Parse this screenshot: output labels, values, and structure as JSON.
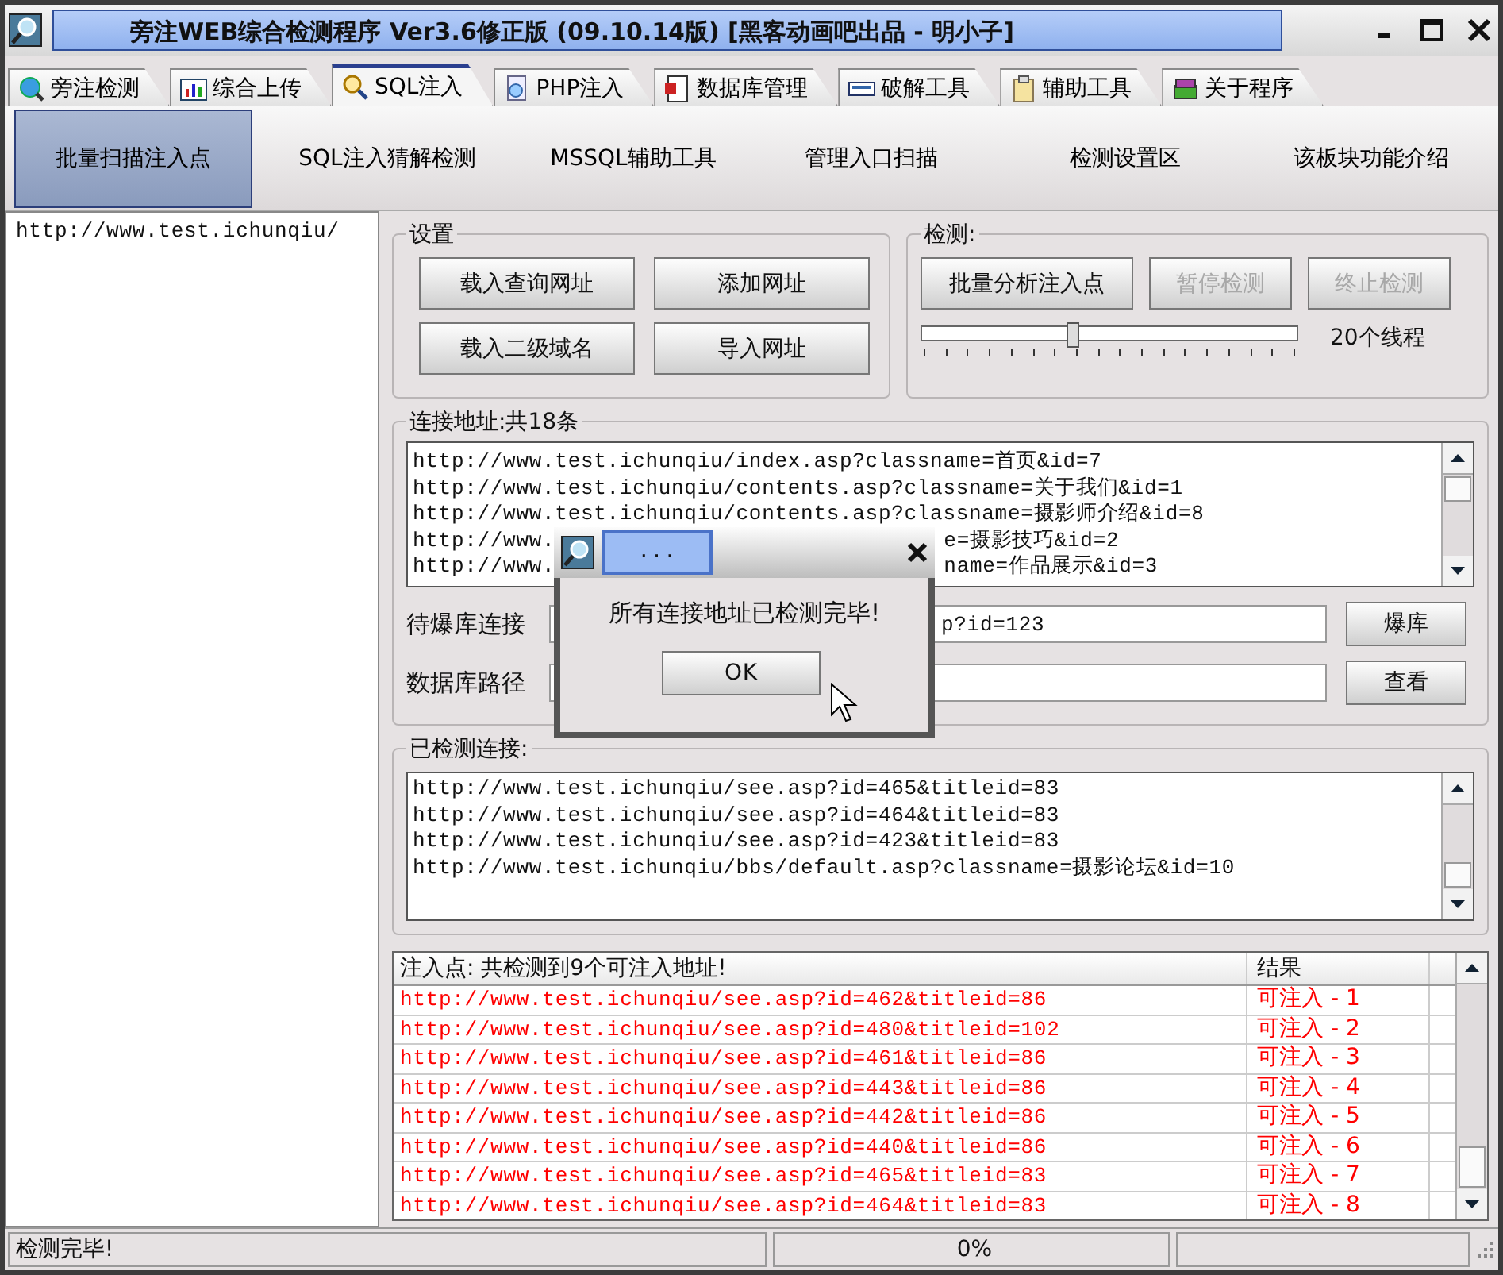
{
  "window": {
    "title": "旁注WEB综合检测程序 Ver3.6修正版 (09.10.14版) [黑客动画吧出品 - 明小子]"
  },
  "tabs": [
    {
      "label": "旁注检测",
      "selected": false
    },
    {
      "label": "综合上传",
      "selected": false
    },
    {
      "label": "SQL注入",
      "selected": true
    },
    {
      "label": "PHP注入",
      "selected": false
    },
    {
      "label": "数据库管理",
      "selected": false
    },
    {
      "label": "破解工具",
      "selected": false
    },
    {
      "label": "辅助工具",
      "selected": false
    },
    {
      "label": "关于程序",
      "selected": false
    }
  ],
  "subtabs": [
    {
      "label": "批量扫描注入点",
      "selected": true
    },
    {
      "label": "SQL注入猜解检测",
      "selected": false
    },
    {
      "label": "MSSQL辅助工具",
      "selected": false
    },
    {
      "label": "管理入口扫描",
      "selected": false
    },
    {
      "label": "检测设置区",
      "selected": false
    },
    {
      "label": "该板块功能介绍",
      "selected": false
    }
  ],
  "sidebar": {
    "items": [
      "http://www.test.ichunqiu/"
    ]
  },
  "settings": {
    "title": "设置",
    "buttons": [
      {
        "label": "载入查询网址",
        "disabled": false
      },
      {
        "label": "添加网址",
        "disabled": false
      },
      {
        "label": "载入二级域名",
        "disabled": false
      },
      {
        "label": "导入网址",
        "disabled": false
      }
    ]
  },
  "detect": {
    "title": "检测:",
    "buttons": [
      {
        "label": "批量分析注入点",
        "disabled": false
      },
      {
        "label": "暂停检测",
        "disabled": true
      },
      {
        "label": "终止检测",
        "disabled": true
      }
    ],
    "threads": {
      "level": 0.4,
      "reading": "20个线程"
    }
  },
  "links": {
    "title": "连接地址:共18条",
    "lines": [
      {
        "left": "http://www.test.ichunqiu/index.asp?classname=首页&id=7"
      },
      {
        "left": "http://www.test.ichunqiu/contents.asp?classname=关于我们&id=1"
      },
      {
        "left": "http://www.test.ichunqiu/contents.asp?classname=摄影师介绍&id=8"
      },
      {
        "left": "http://www.",
        "right": "e=摄影技巧&id=2"
      },
      {
        "left": "http://www.",
        "right": "name=作品展示&id=3"
      }
    ],
    "db_link": {
      "label": "待爆库连接",
      "value": "p?id=123",
      "button": "爆库"
    },
    "db_path": {
      "label": "数据库路径",
      "button": "查看"
    }
  },
  "checked": {
    "title": "已检测连接:",
    "lines": [
      "http://www.test.ichunqiu/see.asp?id=465&titleid=83",
      "http://www.test.ichunqiu/see.asp?id=464&titleid=83",
      "http://www.test.ichunqiu/see.asp?id=423&titleid=83",
      "http://www.test.ichunqiu/bbs/default.asp?classname=摄影论坛&id=10"
    ]
  },
  "results": {
    "columns": [
      "注入点: 共检测到9个可注入地址!",
      "结果"
    ],
    "rows": [
      {
        "url": "http://www.test.ichunqiu/see.asp?id=462&titleid=86",
        "result": "可注入 - 1"
      },
      {
        "url": "http://www.test.ichunqiu/see.asp?id=480&titleid=102",
        "result": "可注入 - 2"
      },
      {
        "url": "http://www.test.ichunqiu/see.asp?id=461&titleid=86",
        "result": "可注入 - 3"
      },
      {
        "url": "http://www.test.ichunqiu/see.asp?id=443&titleid=86",
        "result": "可注入 - 4"
      },
      {
        "url": "http://www.test.ichunqiu/see.asp?id=442&titleid=86",
        "result": "可注入 - 5"
      },
      {
        "url": "http://www.test.ichunqiu/see.asp?id=440&titleid=86",
        "result": "可注入 - 6"
      },
      {
        "url": "http://www.test.ichunqiu/see.asp?id=465&titleid=83",
        "result": "可注入 - 7"
      },
      {
        "url": "http://www.test.ichunqiu/see.asp?id=464&titleid=83",
        "result": "可注入 - 8"
      }
    ]
  },
  "dialog": {
    "title": "...",
    "message": "所有连接地址已检测完毕!",
    "button": "OK"
  },
  "status_bar": {
    "message": "检测完毕!",
    "progress": "0%"
  }
}
